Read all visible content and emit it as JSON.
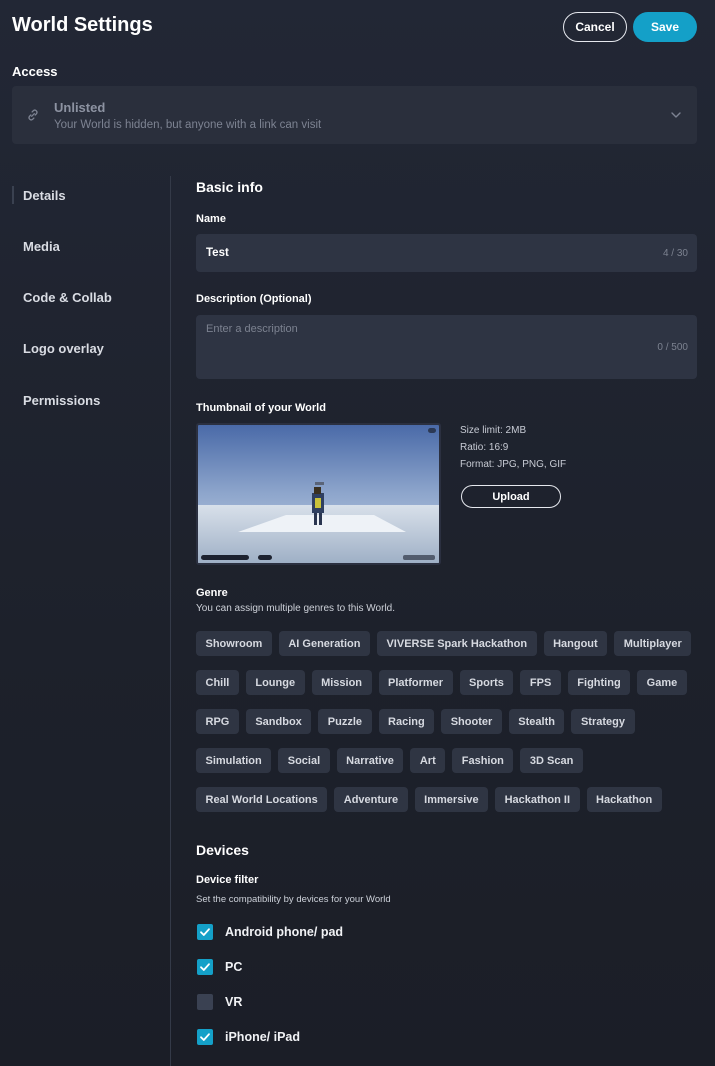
{
  "header": {
    "title": "World Settings",
    "cancel_label": "Cancel",
    "save_label": "Save"
  },
  "access": {
    "label": "Access",
    "selected_title": "Unlisted",
    "selected_description": "Your World is hidden, but anyone with a link can visit",
    "icon": "link-icon"
  },
  "nav": {
    "items": [
      "Details",
      "Media",
      "Code & Collab",
      "Logo overlay",
      "Permissions"
    ],
    "active": "Details"
  },
  "basic_info": {
    "title": "Basic info",
    "name_label": "Name",
    "name_value": "Test",
    "name_counter": "4 / 30",
    "description_label": "Description (Optional)",
    "description_placeholder": "Enter a description",
    "description_counter": "0 / 500"
  },
  "thumbnail": {
    "label": "Thumbnail of your World",
    "size_limit": "Size limit: 2MB",
    "ratio": "Ratio: 16:9",
    "format": "Format: JPG, PNG, GIF",
    "upload_label": "Upload"
  },
  "genre": {
    "label": "Genre",
    "hint": "You can assign multiple genres to this World.",
    "rows": [
      [
        "Showroom",
        "AI Generation",
        "VIVERSE Spark Hackathon",
        "Hangout",
        "Multiplayer"
      ],
      [
        "Chill",
        "Lounge",
        "Mission",
        "Platformer",
        "Sports",
        "FPS",
        "Fighting",
        "Game"
      ],
      [
        "RPG",
        "Sandbox",
        "Puzzle",
        "Racing",
        "Shooter",
        "Stealth",
        "Strategy"
      ],
      [
        "Simulation",
        "Social",
        "Narrative",
        "Art",
        "Fashion",
        "3D Scan"
      ],
      [
        "Real World Locations",
        "Adventure",
        "Immersive",
        "Hackathon II",
        "Hackathon"
      ]
    ]
  },
  "devices": {
    "title": "Devices",
    "filter_label": "Device filter",
    "hint": "Set the compatibility by devices for your World",
    "options": [
      {
        "label": "Android phone/ pad",
        "checked": true
      },
      {
        "label": "PC",
        "checked": true
      },
      {
        "label": "VR",
        "checked": false
      },
      {
        "label": "iPhone/ iPad",
        "checked": true
      }
    ]
  },
  "colors": {
    "accent": "#14a0c8",
    "background": "#1f2330",
    "panel": "#2a2f3c"
  }
}
